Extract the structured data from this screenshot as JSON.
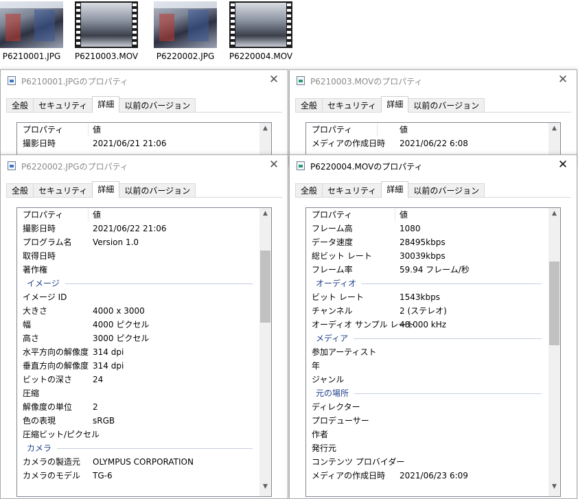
{
  "thumbnails": [
    {
      "name": "P6210001.JPG",
      "kind": "photo"
    },
    {
      "name": "P6210003.MOV",
      "kind": "film"
    },
    {
      "name": "P6220002.JPG",
      "kind": "photo"
    },
    {
      "name": "P6220004.MOV",
      "kind": "film"
    }
  ],
  "tabs": [
    "全般",
    "セキュリティ",
    "詳細",
    "以前のバージョン"
  ],
  "close_symbol": "✕",
  "header": {
    "property": "プロパティ",
    "value": "値"
  },
  "windows": {
    "w1": {
      "title": "P6210001.JPGのプロパティ",
      "rows": [
        {
          "k": "撮影日時",
          "v": "2021/06/21 21:06"
        }
      ]
    },
    "w2": {
      "title": "P6210003.MOVのプロパティ",
      "rows": [
        {
          "k": "メディアの作成日時",
          "v": "2021/06/22 6:08"
        }
      ]
    },
    "w3": {
      "title": "P6220002.JPGのプロパティ",
      "rows": [
        {
          "k": "撮影日時",
          "v": "2021/06/22 21:06"
        },
        {
          "k": "プログラム名",
          "v": "Version 1.0"
        },
        {
          "k": "取得日時",
          "v": ""
        },
        {
          "k": "著作権",
          "v": ""
        },
        {
          "group": "イメージ"
        },
        {
          "k": "イメージ ID",
          "v": ""
        },
        {
          "k": "大きさ",
          "v": "4000 x 3000"
        },
        {
          "k": "幅",
          "v": "4000 ピクセル"
        },
        {
          "k": "高さ",
          "v": "3000 ピクセル"
        },
        {
          "k": "水平方向の解像度",
          "v": "314 dpi"
        },
        {
          "k": "垂直方向の解像度",
          "v": "314 dpi"
        },
        {
          "k": "ビットの深さ",
          "v": "24"
        },
        {
          "k": "圧縮",
          "v": ""
        },
        {
          "k": "解像度の単位",
          "v": "2"
        },
        {
          "k": "色の表現",
          "v": "sRGB"
        },
        {
          "k": "圧縮ビット/ピクセル",
          "v": ""
        },
        {
          "group": "カメラ"
        },
        {
          "k": "カメラの製造元",
          "v": "OLYMPUS CORPORATION"
        },
        {
          "k": "カメラのモデル",
          "v": "TG-6"
        }
      ]
    },
    "w4": {
      "title": "P6220004.MOVのプロパティ",
      "rows": [
        {
          "k": "フレーム高",
          "v": "1080"
        },
        {
          "k": "データ速度",
          "v": "28495kbps"
        },
        {
          "k": "総ビット レート",
          "v": "30039kbps"
        },
        {
          "k": "フレーム率",
          "v": "59.94 フレーム/秒"
        },
        {
          "group": "オーディオ"
        },
        {
          "k": "ビット レート",
          "v": "1543kbps"
        },
        {
          "k": "チャンネル",
          "v": "2 (ステレオ)"
        },
        {
          "k": "オーディオ サンプル レート",
          "v": "48.000 kHz"
        },
        {
          "group": "メディア"
        },
        {
          "k": "参加アーティスト",
          "v": ""
        },
        {
          "k": "年",
          "v": ""
        },
        {
          "k": "ジャンル",
          "v": ""
        },
        {
          "group": "元の場所"
        },
        {
          "k": "ディレクター",
          "v": ""
        },
        {
          "k": "プロデューサー",
          "v": ""
        },
        {
          "k": "作者",
          "v": ""
        },
        {
          "k": "発行元",
          "v": ""
        },
        {
          "k": "コンテンツ プロバイダー",
          "v": ""
        },
        {
          "k": "メディアの作成日時",
          "v": "2021/06/23 6:09"
        }
      ]
    }
  }
}
